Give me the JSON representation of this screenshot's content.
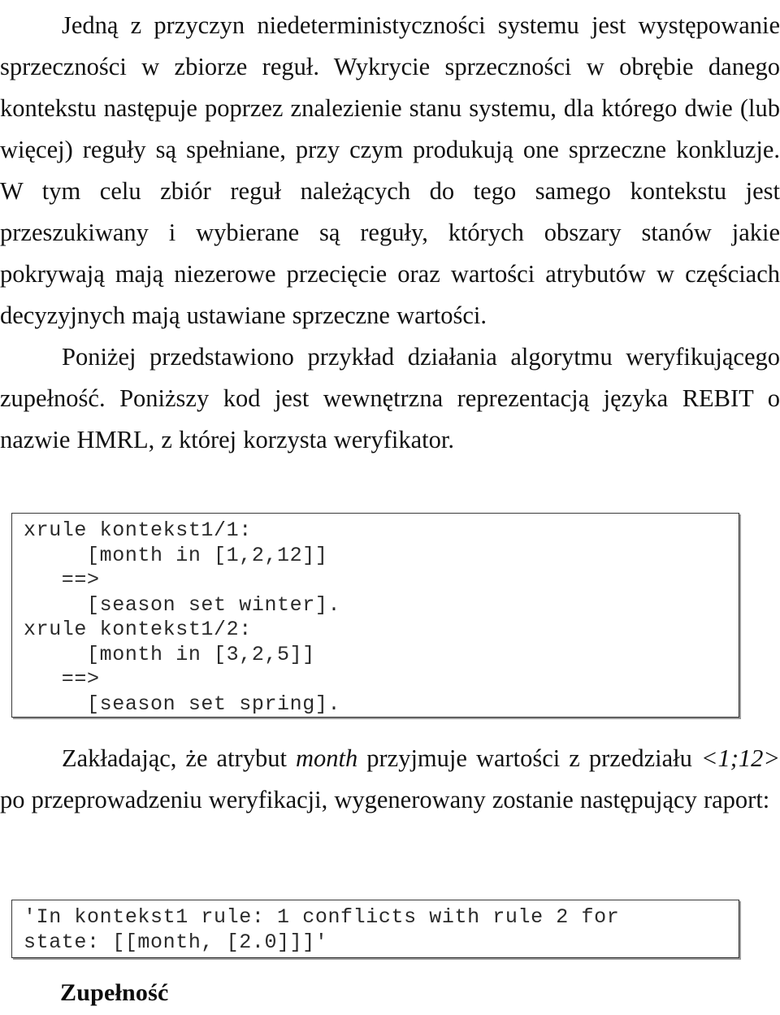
{
  "document": {
    "language": "pl",
    "paragraphs": [
      {
        "id": "p1",
        "indent_first_line": true,
        "text": "Jedną z przyczyn niedeterministyczności systemu jest występowanie sprzeczności w zbiorze reguł. Wykrycie sprzeczności w obrębie danego kontekstu następuje poprzez znalezienie stanu systemu, dla którego dwie (lub więcej) reguły są spełniane, przy czym produkują one sprzeczne konkluzje. W tym celu zbiór reguł należących do tego samego kontekstu jest przeszukiwany i wybierane są reguły, których obszary stanów jakie pokrywają mają niezerowe przecięcie oraz wartości atrybutów w częściach decyzyjnych mają ustawiane sprzeczne wartości."
      },
      {
        "id": "p2",
        "indent_first_line": true,
        "text": "Poniżej przedstawiono przykład działania algorytmu weryfikującego zupełność. Poniższy kod jest wewnętrzna reprezentacją języka REBIT o nazwie HMRL, z której korzysta weryfikator."
      },
      {
        "id": "p3",
        "indent_first_line": true,
        "runs": [
          {
            "style": "normal",
            "text": "Zakładając, że atrybut "
          },
          {
            "style": "italic",
            "text": "month"
          },
          {
            "style": "normal",
            "text": " przyjmuje wartości z przedziału "
          },
          {
            "style": "italic",
            "text": "<1;12>"
          },
          {
            "style": "normal",
            "text": " po przeprowadzeniu weryfikacji, wygenerowany zostanie następujący raport:"
          }
        ],
        "text": "Zakładając, że atrybut month przyjmuje wartości z przedziału <1;12> po przeprowadzeniu weryfikacji, wygenerowany zostanie następujący raport:"
      }
    ],
    "code_blocks": [
      {
        "id": "code-rules",
        "language": "HMRL",
        "lines": [
          "xrule kontekst1/1:",
          "     [month in [1,2,12]]",
          "   ==>",
          "     [season set winter].",
          "xrule kontekst1/2:",
          "     [month in [3,2,5]]",
          "   ==>",
          "     [season set spring]."
        ],
        "text": "xrule kontekst1/1:\n     [month in [1,2,12]]\n   ==>\n     [season set winter].\nxrule kontekst1/2:\n     [month in [3,2,5]]\n   ==>\n     [season set spring]."
      },
      {
        "id": "code-report",
        "language": "report",
        "lines": [
          "'In kontekst1 rule: 1 conflicts with rule 2 for",
          "state: [[month, [2.0]]]'"
        ],
        "text": "'In kontekst1 rule: 1 conflicts with rule 2 for\nstate: [[month, [2.0]]]'"
      }
    ],
    "heading": {
      "text": "Zupełność",
      "level": 2,
      "bold": true
    },
    "colors": {
      "page_background": "#ffffff",
      "body_text": "#111111",
      "code_text": "#2a2a2a",
      "code_border": "#3a3a3a",
      "code_shadow": "#9a9a9a"
    }
  }
}
